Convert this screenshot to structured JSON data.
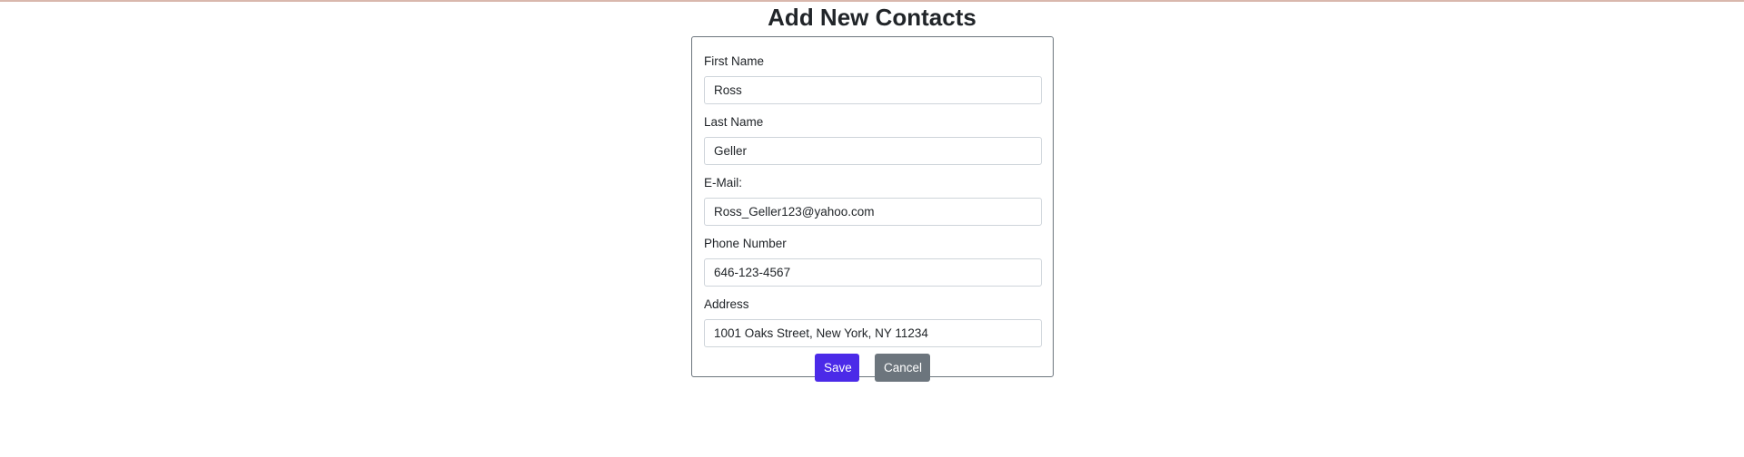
{
  "page": {
    "title": "Add New Contacts"
  },
  "form": {
    "fields": [
      {
        "label": "First Name",
        "value": "Ross"
      },
      {
        "label": "Last Name",
        "value": "Geller"
      },
      {
        "label": "E-Mail:",
        "value": "Ross_Geller123@yahoo.com"
      },
      {
        "label": "Phone Number",
        "value": "646-123-4567"
      },
      {
        "label": "Address",
        "value": "1001 Oaks Street, New York, NY 11234"
      }
    ],
    "save_label": "Save",
    "cancel_label": "Cancel"
  },
  "colors": {
    "save_button": "#4b2ae8",
    "cancel_button": "#6c757d",
    "card_border": "#6c757d",
    "input_border": "#ced4da",
    "top_line": "#d9b8ad"
  }
}
